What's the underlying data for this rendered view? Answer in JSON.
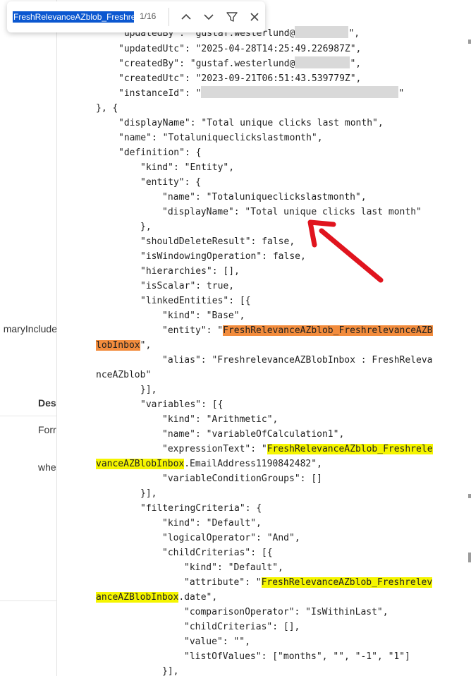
{
  "find_bar": {
    "query": "FreshRelevanceAZblob_Freshre",
    "count": "1/16",
    "prev_icon": "chevron-up-icon",
    "next_icon": "chevron-down-icon",
    "filter_icon": "filter-icon",
    "close_icon": "close-icon"
  },
  "background": {
    "truncated_text": "maryInclude",
    "heading": "Des",
    "row1": "Forr",
    "row2": "whe"
  },
  "code": {
    "l0": "\"updatedBy\": \"gustaf.westerlund@",
    "l0b": "\",",
    "l1": "\"updatedUtc\": \"2025-04-28T14:25:49.226987Z\",",
    "l2a": "\"createdBy\": \"gustaf.westerlund@",
    "l2b": "\",",
    "l3": "\"createdUtc\": \"2023-09-21T06:51:43.539779Z\",",
    "l4a": "\"instanceId\": \"",
    "l4b": "\"",
    "l5": "}, {",
    "l6": "\"displayName\": \"Total unique clicks last month\",",
    "l7": "\"name\": \"Totaluniqueclickslastmonth\",",
    "l8": "\"definition\": {",
    "l9": "\"kind\": \"Entity\",",
    "l10": "\"entity\": {",
    "l11": "\"name\": \"Totaluniqueclickslastmonth\",",
    "l12": "\"displayName\": \"Total unique clicks last month\"",
    "l13": "},",
    "l14": "\"shouldDeleteResult\": false,",
    "l15": "\"isWindowingOperation\": false,",
    "l16": "\"hierarchies\": [],",
    "l17": "\"isScalar\": true,",
    "l18": "\"linkedEntities\": [{",
    "l19": "\"kind\": \"Base\",",
    "l20a": "\"entity\": \"",
    "l20h": "FreshRelevanceAZblob_FreshrelevanceAZB",
    "l21h": "lobInbox",
    "l21b": "\",",
    "l22": "\"alias\": \"FreshrelevanceAZBlobInbox : FreshReleva",
    "l23": "nceAZblob\"",
    "l24": "}],",
    "l25": "\"variables\": [{",
    "l26": "\"kind\": \"Arithmetic\",",
    "l27": "\"name\": \"variableOfCalculation1\",",
    "l28a": "\"expressionText\": \"",
    "l28h": "FreshRelevanceAZblob_Freshrele",
    "l29h": "vanceAZBlobInbox",
    "l29b": ".EmailAddress1190842482\",",
    "l30": "\"variableConditionGroups\": []",
    "l31": "}],",
    "l32": "\"filteringCriteria\": {",
    "l33": "\"kind\": \"Default\",",
    "l34": "\"logicalOperator\": \"And\",",
    "l35": "\"childCriterias\": [{",
    "l36": "\"kind\": \"Default\",",
    "l37a": "\"attribute\": \"",
    "l37h": "FreshRelevanceAZblob_Freshrelev",
    "l38h": "anceAZBlobInbox",
    "l38b": ".date\",",
    "l39": "\"comparisonOperator\": \"IsWithinLast\",",
    "l40": "\"childCriterias\": [],",
    "l41": "\"value\": \"\",",
    "l42": "\"listOfValues\": [\"months\", \"\", \"-1\", \"1\"]",
    "l43": "}],"
  },
  "colors": {
    "current_match": "#f28c3d",
    "other_match": "#f5f500",
    "arrow": "#e0141e"
  }
}
